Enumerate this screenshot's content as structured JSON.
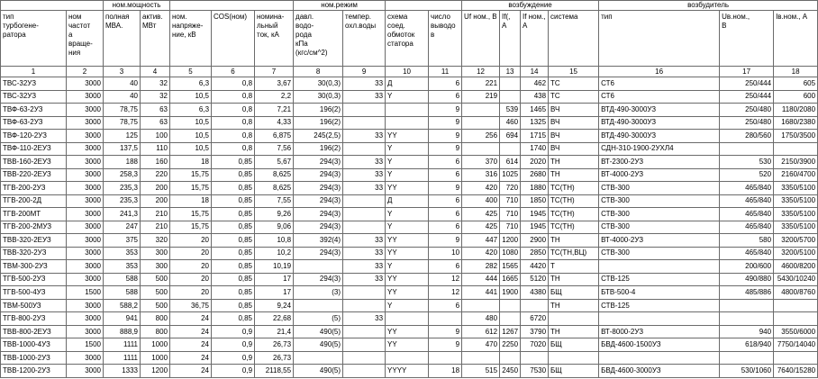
{
  "group_headers": [
    {
      "label": "",
      "span": 2
    },
    {
      "label": "ном.мощность",
      "span": 2
    },
    {
      "label": "",
      "span": 3
    },
    {
      "label": "ном.режим",
      "span": 2
    },
    {
      "label": "",
      "span": 2
    },
    {
      "label": "возбуждение",
      "span": 4
    },
    {
      "label": "возбудитель",
      "span": 3
    }
  ],
  "columns": [
    "тип\nтурбогене-\nратора",
    "ном\nчастот\nа\nвраще-\nния",
    "полная\nМВА.",
    "актив.\nМВт",
    "ном.\nнапряже-\nние, кВ",
    "COS(ном)",
    "номина-\nльный\nток, кА",
    "давл.\nводо-\nрода\nкПа\n(кгс/см^2)",
    "темпер.\nохл.воды",
    "схема\nсоед.\nобмоток\nстатора",
    "число\nвыводо\nв",
    "Uf ном., В",
    "If(,\nА",
    "If ном.,\nА",
    "система",
    "тип",
    "Uв.ном.,\nВ",
    "Iв.ном., А"
  ],
  "column_numbers": [
    "1",
    "2",
    "3",
    "4",
    "5",
    "6",
    "7",
    "8",
    "9",
    "10",
    "11",
    "12",
    "13",
    "14",
    "15",
    "16",
    "17",
    "18"
  ],
  "rows": [
    [
      "ТВС-32УЗ",
      "3000",
      "40",
      "32",
      "6,3",
      "0,8",
      "3,67",
      "30(0,3)",
      "33",
      "Д",
      "6",
      "221",
      "",
      "462",
      "ТС",
      "СТ6",
      "250/444",
      "605"
    ],
    [
      "ТВС-32УЗ",
      "3000",
      "40",
      "32",
      "10,5",
      "0,8",
      "2,2",
      "30(0,3)",
      "33",
      "Y",
      "6",
      "219",
      "",
      "438",
      "ТС",
      "СТ6",
      "250/444",
      "600"
    ],
    [
      "ТВФ-63-2УЗ",
      "3000",
      "78,75",
      "63",
      "6,3",
      "0,8",
      "7,21",
      "196(2)",
      "",
      "",
      "9",
      "",
      "539",
      "1465",
      "ВЧ",
      "ВТД-490-3000УЗ",
      "250/480",
      "1180/2080"
    ],
    [
      "ТВФ-63-2УЗ",
      "3000",
      "78,75",
      "63",
      "10,5",
      "0,8",
      "4,33",
      "196(2)",
      "",
      "",
      "9",
      "",
      "460",
      "1325",
      "ВЧ",
      "ВТД-490-3000УЗ",
      "250/480",
      "1680/2380"
    ],
    [
      "ТВФ-120-2УЗ",
      "3000",
      "125",
      "100",
      "10,5",
      "0,8",
      "6,875",
      "245(2,5)",
      "33",
      "YY",
      "9",
      "256",
      "694",
      "1715",
      "ВЧ",
      "ВТД-490-3000УЗ",
      "280/560",
      "1750/3500"
    ],
    [
      "ТВФ-110-2ЕУЗ",
      "3000",
      "137,5",
      "110",
      "10,5",
      "0,8",
      "7,56",
      "196(2)",
      "",
      "Y",
      "9",
      "",
      "",
      "1740",
      "ВЧ",
      "СДН-310-1900-2УХЛ4",
      "",
      ""
    ],
    [
      "ТВВ-160-2ЕУЗ",
      "3000",
      "188",
      "160",
      "18",
      "0,85",
      "5,67",
      "294(3)",
      "33",
      "Y",
      "6",
      "370",
      "614",
      "2020",
      "ТН",
      "ВТ-2300-2УЗ",
      "530",
      "2150/3900"
    ],
    [
      "ТВВ-220-2ЕУЗ",
      "3000",
      "258,3",
      "220",
      "15,75",
      "0,85",
      "8,625",
      "294(3)",
      "33",
      "Y",
      "6",
      "316",
      "1025",
      "2680",
      "ТН",
      "ВТ-4000-2УЗ",
      "520",
      "2160/4700"
    ],
    [
      "ТГВ-200-2УЗ",
      "3000",
      "235,3",
      "200",
      "15,75",
      "0,85",
      "8,625",
      "294(3)",
      "33",
      "YY",
      "9",
      "420",
      "720",
      "1880",
      "ТС(ТН)",
      "СТВ-300",
      "465/840",
      "3350/5100"
    ],
    [
      "ТГВ-200-2Д",
      "3000",
      "235,3",
      "200",
      "18",
      "0,85",
      "7,55",
      "294(3)",
      "",
      "Д",
      "6",
      "400",
      "710",
      "1850",
      "ТС(ТН)",
      "СТВ-300",
      "465/840",
      "3350/5100"
    ],
    [
      "ТГВ-200МТ",
      "3000",
      "241,3",
      "210",
      "15,75",
      "0,85",
      "9,26",
      "294(3)",
      "",
      "Y",
      "6",
      "425",
      "710",
      "1945",
      "ТС(ТН)",
      "СТВ-300",
      "465/840",
      "3350/5100"
    ],
    [
      "ТГВ-200-2МУЗ",
      "3000",
      "247",
      "210",
      "15,75",
      "0,85",
      "9,06",
      "294(3)",
      "",
      "Y",
      "6",
      "425",
      "710",
      "1945",
      "ТС(ТН)",
      "СТВ-300",
      "465/840",
      "3350/5100"
    ],
    [
      "ТВВ-320-2ЕУЗ",
      "3000",
      "375",
      "320",
      "20",
      "0,85",
      "10,8",
      "392(4)",
      "33",
      "YY",
      "9",
      "447",
      "1200",
      "2900",
      "ТН",
      "ВТ-4000-2УЗ",
      "580",
      "3200/5700"
    ],
    [
      "ТВВ-320-2УЗ",
      "3000",
      "353",
      "300",
      "20",
      "0,85",
      "10,2",
      "294(3)",
      "33",
      "YY",
      "10",
      "420",
      "1080",
      "2850",
      "ТС(ТН,ВЦ)",
      "СТВ-300",
      "465/840",
      "3200/5100"
    ],
    [
      "ТВМ-300-2УЗ",
      "3000",
      "353",
      "300",
      "20",
      "0,85",
      "10,19",
      "",
      "33",
      "Y",
      "6",
      "282",
      "1565",
      "4420",
      "Т",
      "",
      "200/600",
      "4600/8200"
    ],
    [
      "ТГВ-500-2УЗ",
      "3000",
      "588",
      "500",
      "20",
      "0,85",
      "17",
      "294(3)",
      "33",
      "YY",
      "12",
      "444",
      "1665",
      "5120",
      "ТН",
      "СТВ-125",
      "490/880",
      "5430/10240"
    ],
    [
      "ТГВ-500-4УЗ",
      "1500",
      "588",
      "500",
      "20",
      "0,85",
      "17",
      "(3)",
      "",
      "YY",
      "12",
      "441",
      "1900",
      "4380",
      "БЩ",
      "БТВ-500-4",
      "485/886",
      "4800/8760"
    ],
    [
      "ТВМ-500УЗ",
      "3000",
      "588,2",
      "500",
      "36,75",
      "0,85",
      "9,24",
      "",
      "",
      "Y",
      "6",
      "",
      "",
      "",
      "ТН",
      "СТВ-125",
      "",
      ""
    ],
    [
      "ТГВ-800-2УЗ",
      "3000",
      "941",
      "800",
      "24",
      "0,85",
      "22,68",
      "(5)",
      "33",
      "",
      "",
      "480",
      "",
      "6720",
      "",
      "",
      "",
      ""
    ],
    [
      "ТВВ-800-2ЕУЗ",
      "3000",
      "888,9",
      "800",
      "24",
      "0,9",
      "21,4",
      "490(5)",
      "",
      "YY",
      "9",
      "612",
      "1267",
      "3790",
      "ТН",
      "ВТ-8000-2УЗ",
      "940",
      "3550/6000"
    ],
    [
      "ТВВ-1000-4УЗ",
      "1500",
      "1111",
      "1000",
      "24",
      "0,9",
      "26,73",
      "490(5)",
      "",
      "YY",
      "9",
      "470",
      "2250",
      "7020",
      "БЩ",
      "БВД-4600-1500УЗ",
      "618/940",
      "7750/14040"
    ],
    [
      "ТВВ-1000-2УЗ",
      "3000",
      "1111",
      "1000",
      "24",
      "0,9",
      "26,73",
      "",
      "",
      "",
      "",
      "",
      "",
      "",
      "",
      "",
      "",
      ""
    ],
    [
      "ТВВ-1200-2УЗ",
      "3000",
      "1333",
      "1200",
      "24",
      "0,9",
      "2118,55",
      "490(5)",
      "",
      "YYYY",
      "18",
      "515",
      "2450",
      "7530",
      "БЩ",
      "БВД-4600-3000УЗ",
      "530/1060",
      "7640/15280"
    ]
  ]
}
